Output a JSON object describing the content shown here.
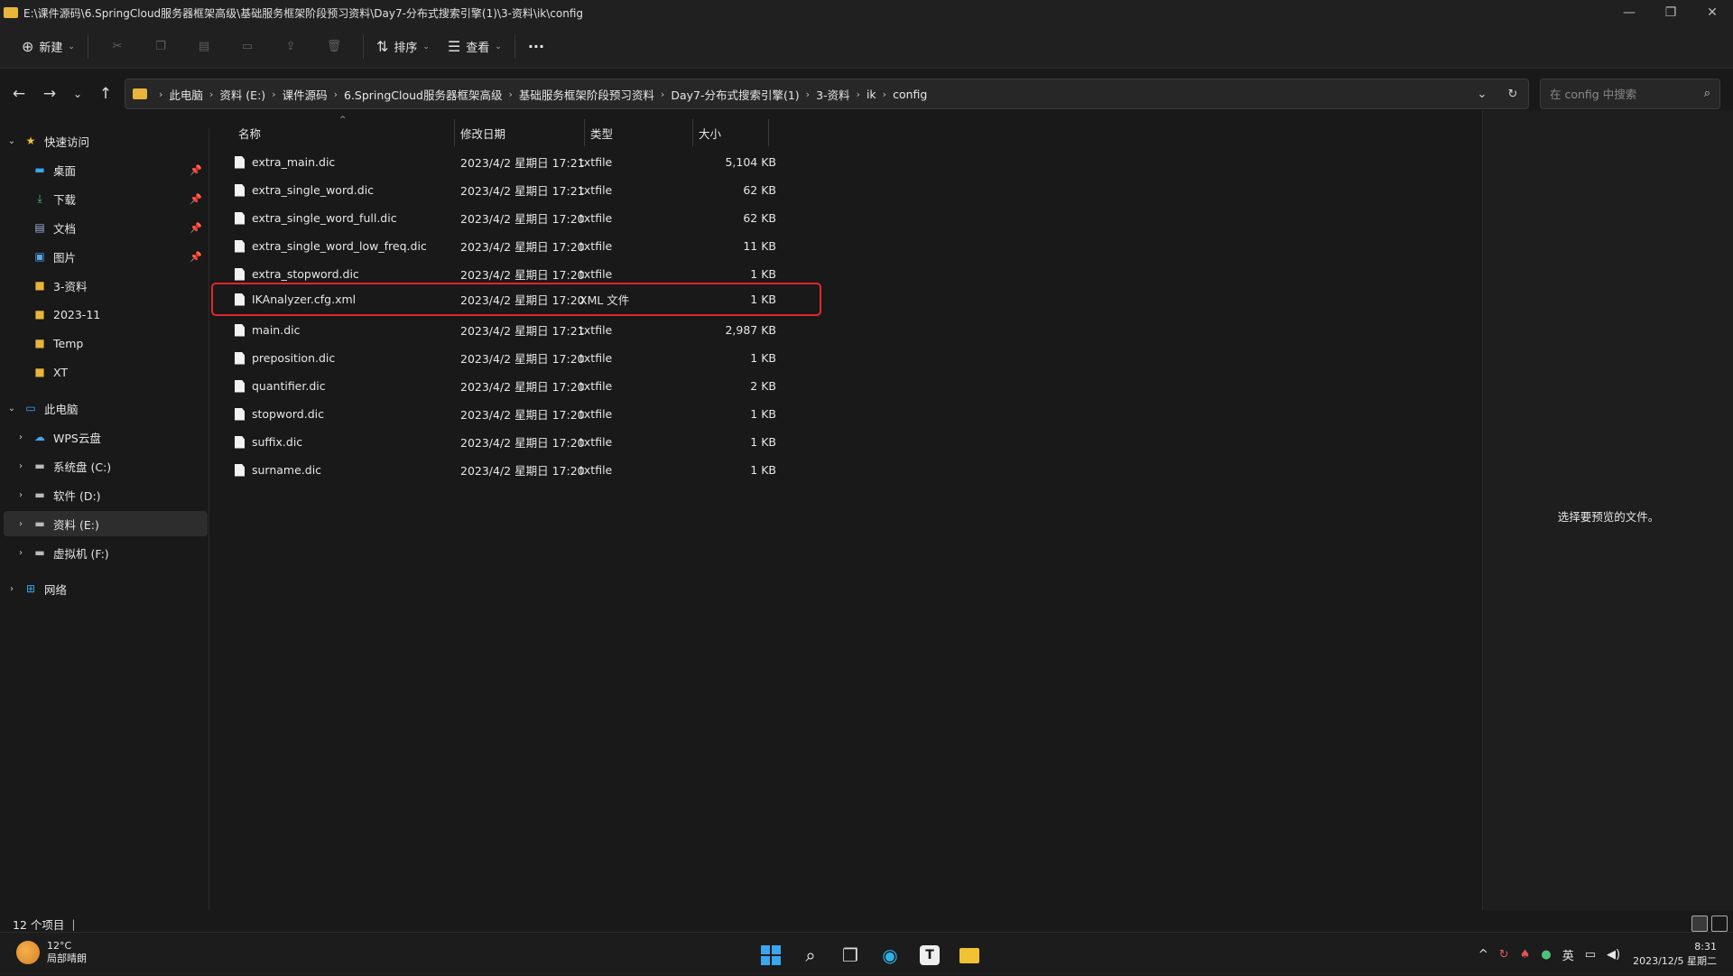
{
  "window": {
    "title": "E:\\课件源码\\6.SpringCloud服务器框架高级\\基础服务框架阶段预习资料\\Day7-分布式搜索引擎(1)\\3-资料\\ik\\config",
    "minimize": "—",
    "restore": "❐",
    "close": "✕"
  },
  "toolbar": {
    "new_label": "新建",
    "sort_label": "排序",
    "view_label": "查看",
    "more_label": "···"
  },
  "address": {
    "crumbs": [
      "此电脑",
      "资料 (E:)",
      "课件源码",
      "6.SpringCloud服务器框架高级",
      "基础服务框架阶段预习资料",
      "Day7-分布式搜索引擎(1)",
      "3-资料",
      "ik",
      "config"
    ],
    "search_placeholder": "在 config 中搜索"
  },
  "nav": {
    "quick_access": "快速访问",
    "items": [
      {
        "label": "桌面",
        "pinned": true
      },
      {
        "label": "下载",
        "pinned": true
      },
      {
        "label": "文档",
        "pinned": true
      },
      {
        "label": "图片",
        "pinned": true
      },
      {
        "label": "3-资料"
      },
      {
        "label": "2023-11"
      },
      {
        "label": "Temp"
      },
      {
        "label": "XT"
      }
    ],
    "this_pc": "此电脑",
    "drives": [
      {
        "label": "WPS云盘"
      },
      {
        "label": "系统盘 (C:)"
      },
      {
        "label": "软件 (D:)"
      },
      {
        "label": "资料 (E:)"
      },
      {
        "label": "虚拟机 (F:)"
      }
    ],
    "network": "网络"
  },
  "columns": {
    "name": "名称",
    "date": "修改日期",
    "type": "类型",
    "size": "大小"
  },
  "files": [
    {
      "name": "extra_main.dic",
      "date": "2023/4/2 星期日 17:21",
      "type": "txtfile",
      "size": "5,104 KB"
    },
    {
      "name": "extra_single_word.dic",
      "date": "2023/4/2 星期日 17:21",
      "type": "txtfile",
      "size": "62 KB"
    },
    {
      "name": "extra_single_word_full.dic",
      "date": "2023/4/2 星期日 17:20",
      "type": "txtfile",
      "size": "62 KB"
    },
    {
      "name": "extra_single_word_low_freq.dic",
      "date": "2023/4/2 星期日 17:20",
      "type": "txtfile",
      "size": "11 KB"
    },
    {
      "name": "extra_stopword.dic",
      "date": "2023/4/2 星期日 17:20",
      "type": "txtfile",
      "size": "1 KB"
    },
    {
      "name": "IKAnalyzer.cfg.xml",
      "date": "2023/4/2 星期日 17:20",
      "type": "XML 文件",
      "size": "1 KB",
      "highlighted": true
    },
    {
      "name": "main.dic",
      "date": "2023/4/2 星期日 17:21",
      "type": "txtfile",
      "size": "2,987 KB"
    },
    {
      "name": "preposition.dic",
      "date": "2023/4/2 星期日 17:20",
      "type": "txtfile",
      "size": "1 KB"
    },
    {
      "name": "quantifier.dic",
      "date": "2023/4/2 星期日 17:20",
      "type": "txtfile",
      "size": "2 KB"
    },
    {
      "name": "stopword.dic",
      "date": "2023/4/2 星期日 17:20",
      "type": "txtfile",
      "size": "1 KB"
    },
    {
      "name": "suffix.dic",
      "date": "2023/4/2 星期日 17:20",
      "type": "txtfile",
      "size": "1 KB"
    },
    {
      "name": "surname.dic",
      "date": "2023/4/2 星期日 17:20",
      "type": "txtfile",
      "size": "1 KB"
    }
  ],
  "preview": {
    "text": "选择要预览的文件。"
  },
  "status": {
    "count": "12 个项目"
  },
  "taskbar": {
    "temp": "12°C",
    "weather": "局部晴朗",
    "ime": "英",
    "time": "8:31",
    "date": "2023/12/5 星期二"
  },
  "colors": {
    "highlight": "#e0262a",
    "folder": "#e8b53b",
    "accent": "#3aa6f0"
  }
}
